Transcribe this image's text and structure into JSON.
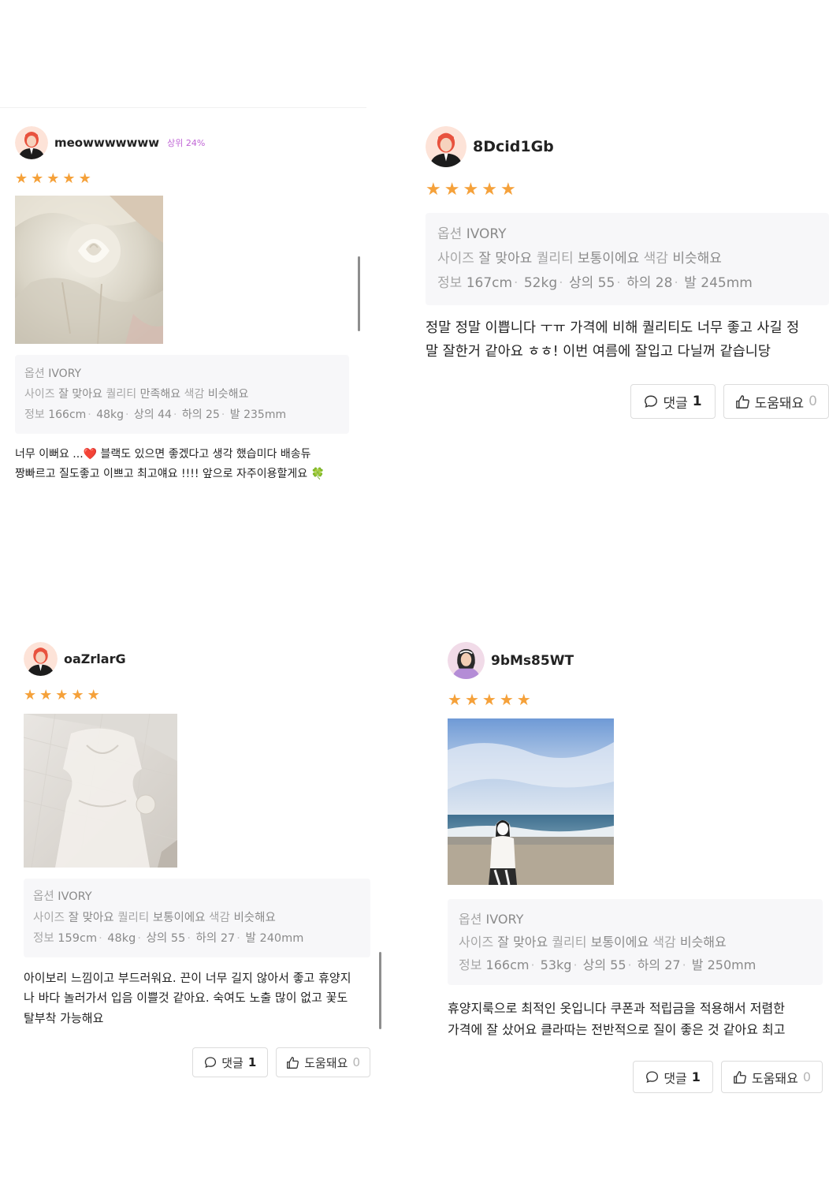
{
  "reviews": [
    {
      "username": "meowwwwwww",
      "badge": "상위 24%",
      "rating": 5,
      "photo": "photo-ivory-rose-closeup",
      "option_label": "옵션",
      "option_value": "IVORY",
      "size_label": "사이즈",
      "size_value": "잘 맞아요",
      "quality_label": "퀄리티",
      "quality_value": "만족해요",
      "color_label": "색감",
      "color_value": "비슷해요",
      "info_label": "정보",
      "info": [
        "166cm",
        "48kg",
        "상의 44",
        "하의 25",
        "발 235mm"
      ],
      "text_line1": "너무 이뻐요 ...❤️ 블랙도 있으면 좋겠다고 생각 했습미다 배송듀",
      "text_line2": "짱빠르고 질도좋고 이쁘고 최고얘요 !!!! 앞으로 자주이용할게요 🍀"
    },
    {
      "username": "8Dcid1Gb",
      "rating": 5,
      "option_label": "옵션",
      "option_value": "IVORY",
      "size_label": "사이즈",
      "size_value": "잘 맞아요",
      "quality_label": "퀄리티",
      "quality_value": "보통이에요",
      "color_label": "색감",
      "color_value": "비슷해요",
      "info_label": "정보",
      "info": [
        "167cm",
        "52kg",
        "상의 55",
        "하의 28",
        "발 245mm"
      ],
      "text_line1": "정말 정말 이쁩니다 ㅜㅠ 가격에 비해 퀄리티도 너무 좋고 사길 정",
      "text_line2": "말 잘한거 같아요 ㅎㅎ! 이번 여름에 잘입고 다닐꺼 같습니당",
      "comment_label": "댓글",
      "comment_count": "1",
      "helpful_label": "도움돼요",
      "helpful_count": "0"
    },
    {
      "username": "oaZrlarG",
      "rating": 5,
      "photo": "photo-ivory-dress-on-bed",
      "option_label": "옵션",
      "option_value": "IVORY",
      "size_label": "사이즈",
      "size_value": "잘 맞아요",
      "quality_label": "퀄리티",
      "quality_value": "보통이에요",
      "color_label": "색감",
      "color_value": "비슷해요",
      "info_label": "정보",
      "info": [
        "159cm",
        "48kg",
        "상의 55",
        "하의 27",
        "발 240mm"
      ],
      "text_line1": "아이보리 느낌이고 부드러워요. 끈이 너무 길지 않아서 좋고 휴양지",
      "text_line2": "나 바다 놀러가서 입음 이쁠것 같아요. 숙여도 노출 많이 없고 꽃도",
      "text_line3": "탈부착 가능해요",
      "comment_label": "댓글",
      "comment_count": "1",
      "helpful_label": "도움돼요",
      "helpful_count": "0"
    },
    {
      "username": "9bMs85WT",
      "rating": 5,
      "photo": "photo-woman-at-beach",
      "option_label": "옵션",
      "option_value": "IVORY",
      "size_label": "사이즈",
      "size_value": "잘 맞아요",
      "quality_label": "퀄리티",
      "quality_value": "보통이에요",
      "color_label": "색감",
      "color_value": "비슷해요",
      "info_label": "정보",
      "info": [
        "166cm",
        "53kg",
        "상의 55",
        "하의 27",
        "발 250mm"
      ],
      "text_line1": "휴양지룩으로 최적인 옷입니다 쿠폰과 적립금을 적용해서 저렴한",
      "text_line2": "가격에 잘 샀어요 클라따는 전반적으로 질이 좋은 것 같아요 최고",
      "comment_label": "댓글",
      "comment_count": "1",
      "helpful_label": "도움돼요",
      "helpful_count": "0"
    }
  ],
  "icons": {
    "star": "★",
    "comment": "speech-bubble-icon",
    "helpful": "thumbs-up-icon"
  },
  "colors": {
    "star": "#f5a13a",
    "badge": "#c066d6",
    "infobox_bg": "#f7f7f9"
  }
}
